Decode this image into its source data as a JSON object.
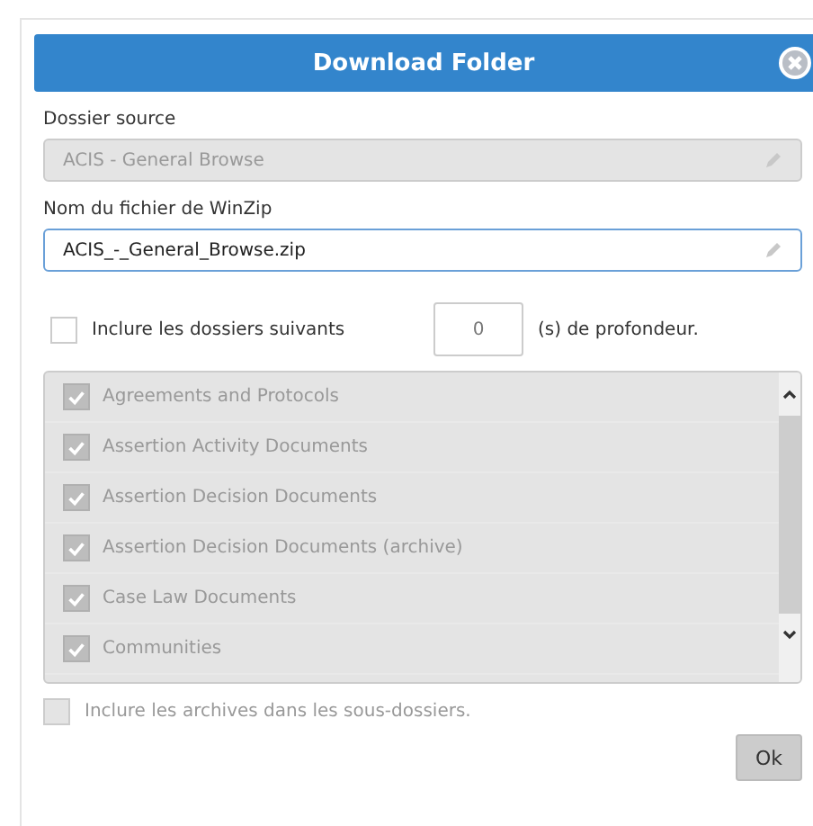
{
  "dialog": {
    "title": "Download Folder"
  },
  "source_folder": {
    "label": "Dossier source",
    "value": "ACIS - General Browse",
    "disabled": true
  },
  "zip_name": {
    "label": "Nom du fichier de WinZip",
    "value": "ACIS_-_General_Browse.zip",
    "disabled": false
  },
  "include_subfolders": {
    "checked": false,
    "label": "Inclure les dossiers suivants",
    "depth": "0",
    "depth_suffix": "(s) de profondeur."
  },
  "folders": [
    {
      "label": "Agreements and Protocols",
      "checked": true,
      "disabled": true
    },
    {
      "label": "Assertion Activity Documents",
      "checked": true,
      "disabled": true
    },
    {
      "label": "Assertion Decision Documents",
      "checked": true,
      "disabled": true
    },
    {
      "label": "Assertion Decision Documents (archive)",
      "checked": true,
      "disabled": true
    },
    {
      "label": "Case Law Documents",
      "checked": true,
      "disabled": true
    },
    {
      "label": "Communities",
      "checked": true,
      "disabled": true
    }
  ],
  "include_archives": {
    "checked": false,
    "disabled": true,
    "label": "Inclure les archives dans les sous-dossiers."
  },
  "ok_button": "Ok"
}
